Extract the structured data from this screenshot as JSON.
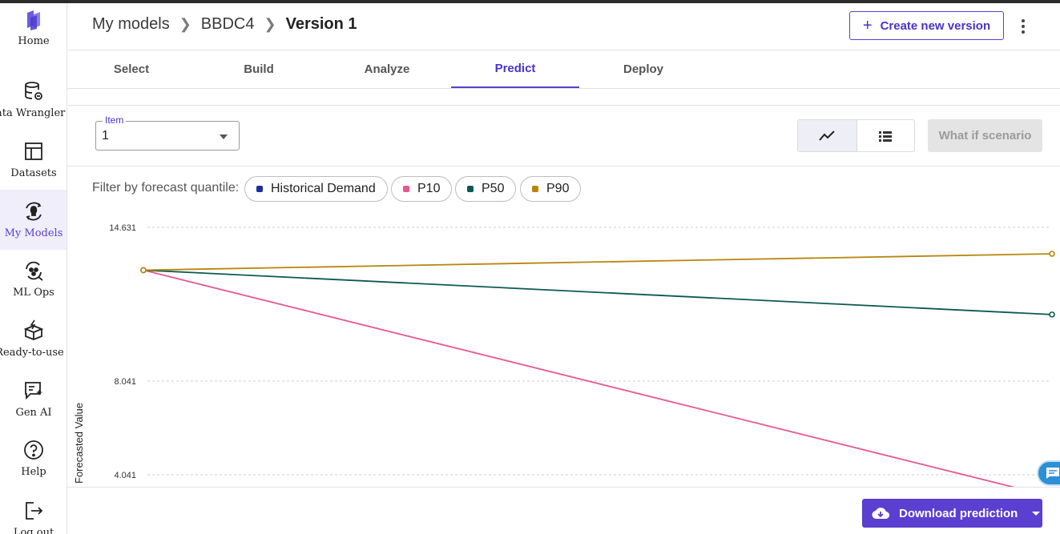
{
  "sidebar": {
    "items": [
      {
        "label": "Home",
        "icon": "home-logo-icon"
      },
      {
        "label": "Data Wrangler",
        "icon": "database-icon"
      },
      {
        "label": "Datasets",
        "icon": "table-icon"
      },
      {
        "label": "My Models",
        "icon": "models-bulb-icon",
        "active": true
      },
      {
        "label": "ML Ops",
        "icon": "mlops-icon"
      },
      {
        "label": "Ready-to-use",
        "icon": "ready-box-icon"
      },
      {
        "label": "Gen AI",
        "icon": "gen-ai-chat-icon"
      },
      {
        "label": "Help",
        "icon": "help-circle-icon"
      },
      {
        "label": "Log out",
        "icon": "logout-icon"
      }
    ]
  },
  "header": {
    "breadcrumb": [
      "My models",
      "BBDC4",
      "Version 1"
    ],
    "create_button": "Create new version"
  },
  "tabs": [
    "Select",
    "Build",
    "Analyze",
    "Predict",
    "Deploy"
  ],
  "active_tab": "Predict",
  "controls": {
    "item_label": "Item",
    "item_value": "1",
    "whatif_button": "What if scenario"
  },
  "filter": {
    "label": "Filter by forecast quantile:",
    "chips": [
      {
        "label": "Historical Demand",
        "color": "#1a2fa0"
      },
      {
        "label": "P10",
        "color": "#e8588f"
      },
      {
        "label": "P50",
        "color": "#0b5a52"
      },
      {
        "label": "P90",
        "color": "#b8860b"
      }
    ]
  },
  "chart_data": {
    "type": "line",
    "ylabel": "Forecasted Value",
    "yticks": [
      "14.631",
      "8.041",
      "4.041"
    ],
    "ylim": [
      3.7,
      14.631
    ],
    "grid": true,
    "series": [
      {
        "name": "P10",
        "color": "#e8588f",
        "x": [
          0,
          1
        ],
        "y": [
          12.8,
          3.1
        ]
      },
      {
        "name": "P50",
        "color": "#0b5a52",
        "x": [
          0,
          1
        ],
        "y": [
          12.8,
          10.9
        ]
      },
      {
        "name": "P90",
        "color": "#b8860b",
        "x": [
          0,
          1
        ],
        "y": [
          12.8,
          13.5
        ]
      }
    ]
  },
  "footer": {
    "download_button": "Download prediction"
  }
}
